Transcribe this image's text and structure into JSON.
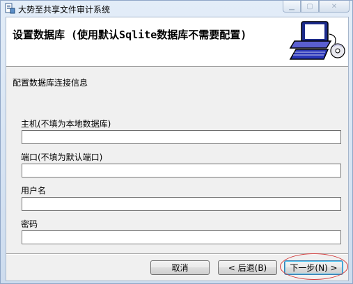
{
  "window": {
    "title": "大势至共享文件审计系统"
  },
  "banner": {
    "title": "设置数据库 (使用默认Sqlite数据库不需要配置)"
  },
  "form": {
    "section_label": "配置数据库连接信息",
    "fields": [
      {
        "label": "主机(不填为本地数据库)",
        "value": ""
      },
      {
        "label": "端口(不填为默认端口)",
        "value": ""
      },
      {
        "label": "用户名",
        "value": ""
      },
      {
        "label": "密码",
        "value": ""
      }
    ]
  },
  "buttons": {
    "cancel": "取消",
    "back": "< 后退(B)",
    "next": "下一步(N) >"
  },
  "colors": {
    "highlight": "#d33a3a",
    "window_frame": "#cddcee",
    "default_button_focus": "#48c0f0"
  }
}
